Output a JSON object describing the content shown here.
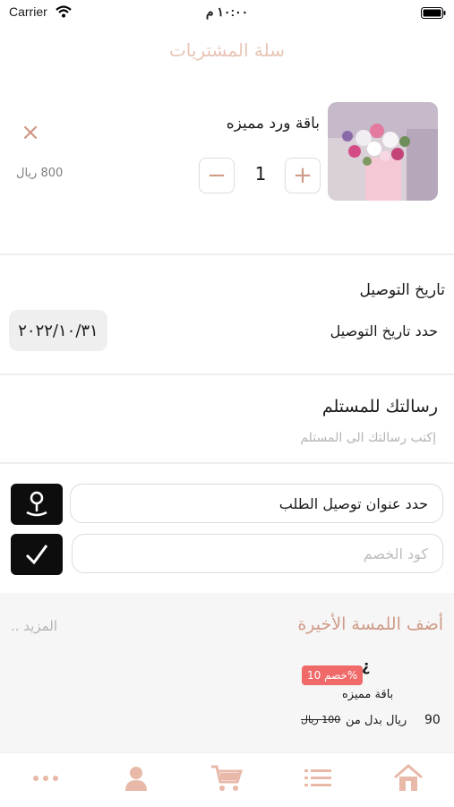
{
  "status_bar": {
    "carrier": "Carrier",
    "time": "١٠:٠٠ م"
  },
  "header": {
    "title": "سلة المشتريات"
  },
  "cart_item": {
    "name": "باقة ورد مميزه",
    "quantity": "1",
    "price": "800 ريال",
    "minus_label": "−",
    "plus_label": "+",
    "remove_label": "×"
  },
  "delivery": {
    "section_title": "تاريخ التوصيل",
    "prompt": "حدد تاريخ التوصيل",
    "date": "٢٠٢٢/١٠/٣١"
  },
  "message": {
    "section_title": "رسالتك للمستلم",
    "placeholder": "إكتب رسالتك الى المستلم"
  },
  "address": {
    "label": "حدد عنوان توصيل الطلب"
  },
  "discount": {
    "placeholder": "كود الخصم"
  },
  "final_touch": {
    "title": "أضف اللمسة الأخيرة",
    "more": "المزيد ..",
    "item": {
      "badge": "خصم 10%",
      "name": "باقة مميزه",
      "price_new": "90",
      "price_text": "ريال بدل من",
      "price_old": "100 ريال"
    }
  },
  "colors": {
    "accent": "#cf9b88",
    "title": "#e8c5b6",
    "badge": "#f06a6a",
    "tab_icon": "#e8b9a8"
  },
  "tabs": [
    {
      "name": "home",
      "icon": "home-icon"
    },
    {
      "name": "list",
      "icon": "list-icon"
    },
    {
      "name": "cart",
      "icon": "cart-icon"
    },
    {
      "name": "profile",
      "icon": "user-icon"
    },
    {
      "name": "more",
      "icon": "more-icon"
    }
  ]
}
